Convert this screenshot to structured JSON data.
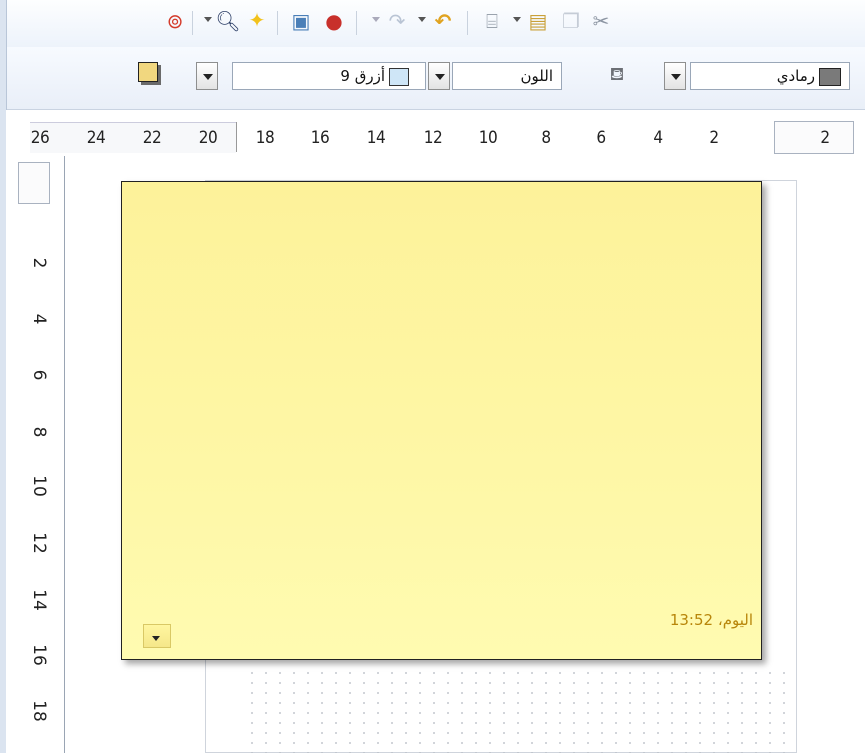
{
  "toolbar1": {
    "icons": [
      "help-icon",
      "dropdown-icon",
      "zoom-icon",
      "sparkle-icon",
      "image-icon",
      "color-palette-icon",
      "dropdown-icon",
      "redo-icon",
      "dropdown-icon",
      "undo-icon",
      "paint-brush-icon",
      "dropdown-icon",
      "paste-icon",
      "copy-icon",
      "cut-icon"
    ]
  },
  "toolbar2": {
    "line_color": {
      "label": "رمادي",
      "swatch": "#7a7a7a"
    },
    "area_style_label": "اللون",
    "fill_color": {
      "label": "أزرق 9",
      "swatch": "#cfe6f7"
    },
    "shadow_swatch": "#f1d77f"
  },
  "hruler": {
    "right_box": "2",
    "numbers": [
      "2",
      "4",
      "6",
      "8",
      "10",
      "12",
      "14",
      "16",
      "18",
      "20",
      "22",
      "24",
      "26"
    ]
  },
  "vruler": {
    "numbers": [
      "2",
      "4",
      "6",
      "8",
      "10",
      "12",
      "14",
      "16",
      "18"
    ]
  },
  "note": {
    "timestamp": "اليوم، 13:52",
    "color": "#fef5a4"
  }
}
